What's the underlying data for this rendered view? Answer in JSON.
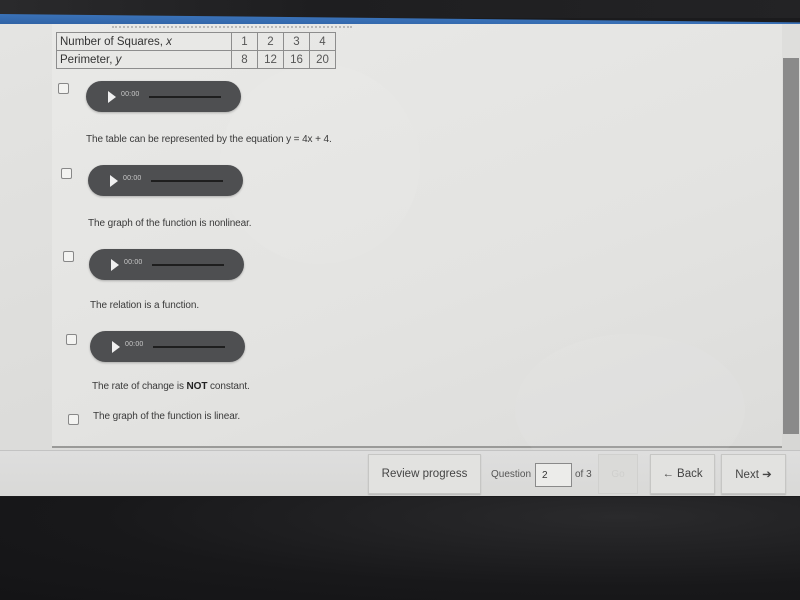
{
  "table": {
    "rows": [
      {
        "label": "Number of Squares, ",
        "var": "x",
        "values": [
          "1",
          "2",
          "3",
          "4"
        ]
      },
      {
        "label": "Perimeter, ",
        "var": "y",
        "values": [
          "8",
          "12",
          "16",
          "20"
        ]
      }
    ]
  },
  "options": [
    {
      "audio_time": "00:00",
      "text": "The table can be represented by the equation y = 4x + 4.",
      "checked": false
    },
    {
      "audio_time": "00:00",
      "text": "The graph of the function is nonlinear.",
      "checked": false
    },
    {
      "audio_time": "00:00",
      "text": "The relation is a function.",
      "checked": false
    },
    {
      "audio_time": "00:00",
      "text_before": "The rate of change is ",
      "text_bold": "NOT",
      "text_after": " constant.",
      "checked": false
    },
    {
      "text": "The graph of the function is linear.",
      "checked": false
    }
  ],
  "footer": {
    "review_label": "Review progress",
    "question_label": "Question",
    "question_value": "2",
    "of_label": "of 3",
    "go_label": "Go",
    "back_label": "← Back",
    "next_label": "Next ➔"
  },
  "colors": {
    "accent_blue": "#2c5d9e",
    "audio_bg": "#4e4f51"
  }
}
